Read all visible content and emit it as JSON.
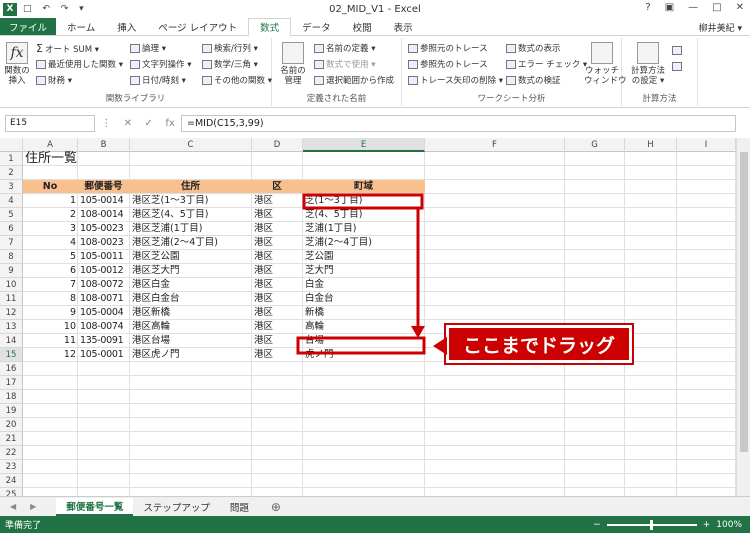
{
  "window": {
    "title": "02_MID_V1 - Excel",
    "app_icon": "X",
    "quick_access": "□ ↶ ↷ ▾",
    "controls": [
      "?",
      "▣",
      "—",
      "□",
      "✕"
    ]
  },
  "tabs": [
    "ファイル",
    "ホーム",
    "挿入",
    "ページ レイアウト",
    "数式",
    "データ",
    "校閲",
    "表示"
  ],
  "user": "柳井美紀 ▾",
  "ribbon": {
    "fx_label": "関数の\n挿入",
    "autosum": "オート SUM ▾",
    "recent": "最近使用した関数 ▾",
    "finance": "財務 ▾",
    "logic": "論理 ▾",
    "text": "文字列操作 ▾",
    "datetime": "日付/時刻 ▾",
    "lookup": "検索/行列 ▾",
    "math": "数学/三角 ▾",
    "more": "その他の関数 ▾",
    "group_lib": "関数ライブラリ",
    "name_mgr": "名前の\n管理",
    "define": "名前の定義 ▾",
    "use_formula": "数式で使用 ▾",
    "create_sel": "選択範囲から作成",
    "group_names": "定義された名前",
    "trace_prec": "参照元のトレース",
    "trace_dep": "参照先のトレース",
    "remove_arrows": "トレース矢印の削除 ▾",
    "show_formulas": "数式の表示",
    "error_check": "エラー チェック ▾",
    "evaluate": "数式の検証",
    "watch": "ウォッチ\nウィンドウ",
    "group_audit": "ワークシート分析",
    "calc_opt": "計算方法\nの設定 ▾",
    "group_calc": "計算方法"
  },
  "formula_bar": {
    "name_box": "E15",
    "buttons": [
      "⋮",
      "✕",
      "✓",
      "fx"
    ],
    "formula": "=MID(C15,3,99)"
  },
  "columns": [
    "A",
    "B",
    "C",
    "D",
    "E",
    "F",
    "G",
    "H",
    "I"
  ],
  "rows": [
    "1",
    "2",
    "3",
    "4",
    "5",
    "6",
    "7",
    "8",
    "9",
    "10",
    "11",
    "12",
    "13",
    "14",
    "15",
    "16",
    "17",
    "18",
    "19",
    "20",
    "21",
    "22",
    "23",
    "24",
    "25"
  ],
  "sheet": {
    "title": "住所一覧",
    "headers": [
      "No",
      "郵便番号",
      "住所",
      "区",
      "町域"
    ],
    "data": [
      [
        "1",
        "105-0014",
        "港区芝(1～3丁目)",
        "港区",
        "芝(1～3丁目)"
      ],
      [
        "2",
        "108-0014",
        "港区芝(4、5丁目)",
        "港区",
        "芝(4、5丁目)"
      ],
      [
        "3",
        "105-0023",
        "港区芝浦(1丁目)",
        "港区",
        "芝浦(1丁目)"
      ],
      [
        "4",
        "108-0023",
        "港区芝浦(2～4丁目)",
        "港区",
        "芝浦(2～4丁目)"
      ],
      [
        "5",
        "105-0011",
        "港区芝公園",
        "港区",
        "芝公園"
      ],
      [
        "6",
        "105-0012",
        "港区芝大門",
        "港区",
        "芝大門"
      ],
      [
        "7",
        "108-0072",
        "港区白金",
        "港区",
        "白金"
      ],
      [
        "8",
        "108-0071",
        "港区白金台",
        "港区",
        "白金台"
      ],
      [
        "9",
        "105-0004",
        "港区新橋",
        "港区",
        "新橋"
      ],
      [
        "10",
        "108-0074",
        "港区高輪",
        "港区",
        "高輪"
      ],
      [
        "11",
        "135-0091",
        "港区台場",
        "港区",
        "台場"
      ],
      [
        "12",
        "105-0001",
        "港区虎ノ門",
        "港区",
        "虎ノ門"
      ]
    ]
  },
  "sheet_tabs": [
    "郵便番号一覧",
    "ステップアップ",
    "問題"
  ],
  "sheet_nav": [
    "◀",
    "▶"
  ],
  "add_sheet": "⊕",
  "status": {
    "text": "準備完了",
    "zoom": "100%",
    "zoom_minus": "−",
    "zoom_plus": "+"
  },
  "callout": "ここまでドラッグ",
  "colors": {
    "excel_green": "#217346",
    "header_fill": "#f8c08f",
    "callout_red": "#cc0000"
  }
}
